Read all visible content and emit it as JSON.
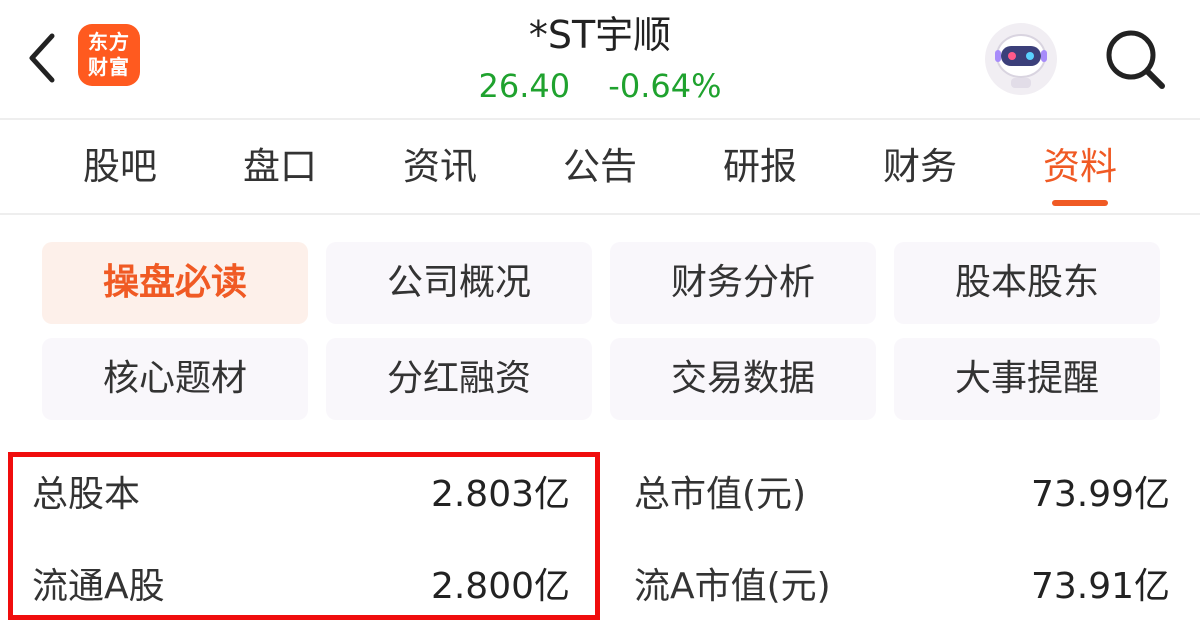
{
  "header": {
    "logo_line1": "东方",
    "logo_line2": "财富",
    "stock_name": "*ST宇顺",
    "price": "26.40",
    "change_pct": "-0.64%",
    "price_color": "#1fa22e",
    "back_icon": "chevron-left-icon",
    "avatar_icon": "robot-avatar-icon",
    "search_icon": "search-icon"
  },
  "tabs": [
    {
      "label": "股吧"
    },
    {
      "label": "盘口"
    },
    {
      "label": "资讯"
    },
    {
      "label": "公告"
    },
    {
      "label": "研报"
    },
    {
      "label": "财务"
    },
    {
      "label": "资料",
      "active": true
    }
  ],
  "accent_color": "#f05a24",
  "subcategories": [
    {
      "label": "操盘必读",
      "active": true
    },
    {
      "label": "公司概况"
    },
    {
      "label": "财务分析"
    },
    {
      "label": "股本股东"
    },
    {
      "label": "核心题材"
    },
    {
      "label": "分红融资"
    },
    {
      "label": "交易数据"
    },
    {
      "label": "大事提醒"
    }
  ],
  "stats": {
    "left": [
      {
        "label": "总股本",
        "value": "2.803亿"
      },
      {
        "label": "流通A股",
        "value": "2.800亿"
      }
    ],
    "right": [
      {
        "label": "总市值(元)",
        "value": "73.99亿"
      },
      {
        "label": "流A市值(元)",
        "value": "73.91亿"
      }
    ]
  },
  "highlight_color": "#f00d0d"
}
